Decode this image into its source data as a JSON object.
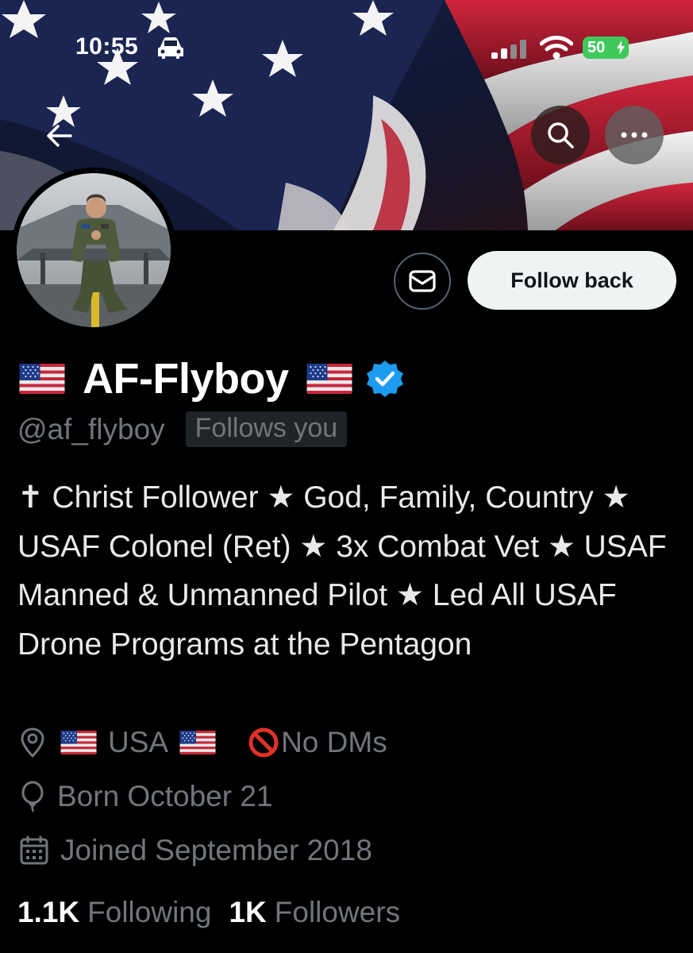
{
  "status_bar": {
    "time": "10:55",
    "battery": "50"
  },
  "profile": {
    "display_name": "AF-Flyboy",
    "handle": "@af_flyboy",
    "follows_you_badge": "Follows you",
    "bio": "✝ Christ Follower ★ God, Family, Country ★ USAF Colonel (Ret) ★ 3x Combat Vet ★ USAF Manned & Unmanned Pilot ★ Led All USAF Drone Programs at the Pentagon",
    "verified": true,
    "location": "USA",
    "dm_note": "No DMs",
    "birthday": "Born October 21",
    "joined": "Joined September 2018"
  },
  "actions": {
    "follow_back_label": "Follow back"
  },
  "stats": {
    "following_count": "1.1K",
    "following_label": "Following",
    "followers_count": "1K",
    "followers_label": "Followers"
  },
  "icons": {
    "back": "arrow-left-icon",
    "search": "search-icon",
    "more": "more-icon",
    "message": "envelope-icon",
    "verified": "verified-badge-icon",
    "location": "location-pin-icon",
    "birthday": "balloon-icon",
    "joined": "calendar-icon",
    "no_entry": "no-entry-icon",
    "flag": "us-flag-icon",
    "car": "car-icon",
    "signal": "signal-icon",
    "wifi": "wifi-icon"
  },
  "colors": {
    "background": "#000000",
    "primary_text": "#e7e9ea",
    "secondary_text": "#71767b",
    "verified_blue": "#1d9bf0",
    "battery_green": "#3fc95a",
    "follow_button_bg": "#eff3f4"
  }
}
